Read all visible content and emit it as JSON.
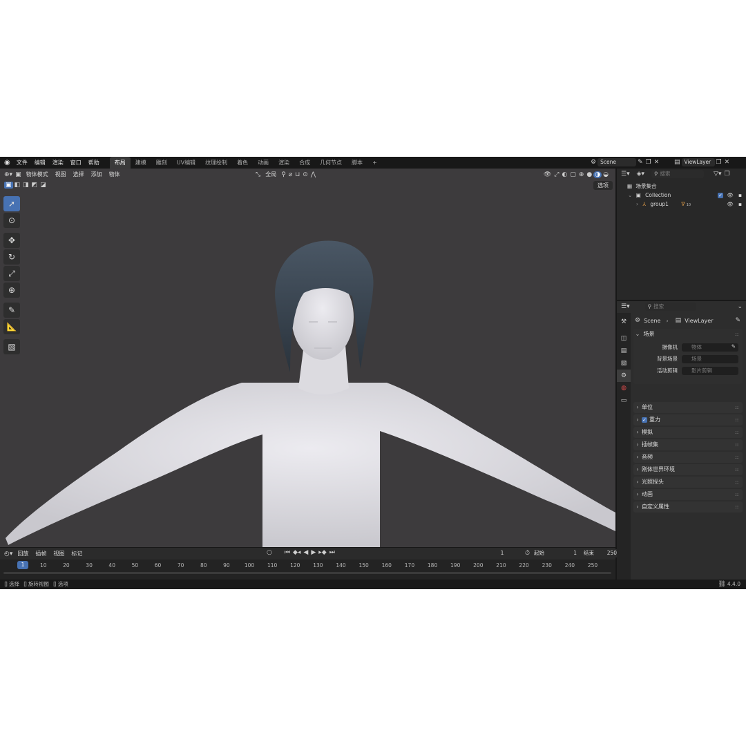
{
  "menubar": {
    "items": [
      "文件",
      "编辑",
      "渲染",
      "窗口",
      "帮助"
    ],
    "workspaces": [
      "布局",
      "建模",
      "雕刻",
      "UV编辑",
      "纹理绘制",
      "着色",
      "动画",
      "渲染",
      "合成",
      "几何节点",
      "脚本"
    ],
    "active_workspace": "布局",
    "add_tab": "+",
    "scene": "Scene",
    "view_layer": "ViewLayer"
  },
  "viewport": {
    "mode": "物体模式",
    "menus": [
      "视图",
      "选择",
      "添加",
      "物体"
    ],
    "orientation": "全局",
    "select_button": "选项"
  },
  "outliner": {
    "search_placeholder": "搜索",
    "scene_collection": "场景集合",
    "collection": "Collection",
    "object": "group1",
    "object_badge": "10"
  },
  "properties": {
    "search_placeholder": "搜索",
    "breadcrumb_scene": "Scene",
    "breadcrumb_viewlayer": "ViewLayer",
    "scene_panel": "场景",
    "fields": [
      {
        "label": "摄像机",
        "placeholder": "物体"
      },
      {
        "label": "背景场景",
        "placeholder": "场景"
      },
      {
        "label": "活动剪辑",
        "placeholder": "影片剪辑"
      }
    ],
    "panels": [
      "单位",
      "重力",
      "模拟",
      "插帧集",
      "音频",
      "刚体世界环境",
      "光照探头",
      "动画",
      "自定义属性"
    ],
    "gravity_checked": true
  },
  "timeline": {
    "playback": "回放",
    "keying": "插帧",
    "view": "视图",
    "marker": "标记",
    "current_frame": "1",
    "start_label": "起始",
    "start": "1",
    "end_label": "结束",
    "end": "250",
    "ticks": [
      "1",
      "10",
      "20",
      "30",
      "40",
      "50",
      "60",
      "70",
      "80",
      "90",
      "100",
      "110",
      "120",
      "130",
      "140",
      "150",
      "160",
      "170",
      "180",
      "190",
      "200",
      "210",
      "220",
      "230",
      "240",
      "250"
    ]
  },
  "statusbar": {
    "select": "选择",
    "rotate": "旋转视图",
    "options": "选项",
    "version": "4.4.0"
  },
  "colors": {
    "accent": "#4772b3",
    "viewport_bg": "#3d3b3d",
    "skin": "#e4e3e8",
    "hair": "#3c4854"
  }
}
